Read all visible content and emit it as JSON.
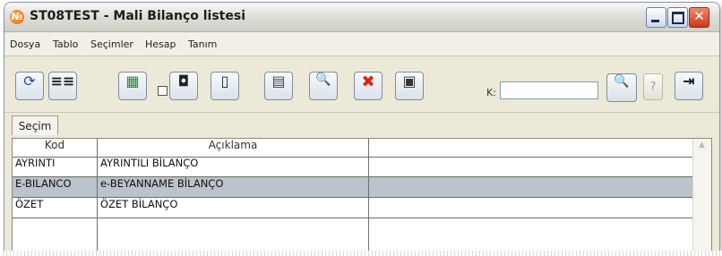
{
  "window": {
    "title": "ST08TEST - Mali Bilanço listesi",
    "app_icon_letter": "№",
    "controls": {
      "minimize": "_",
      "maximize": "□",
      "close": "✕"
    }
  },
  "menu": [
    {
      "label": "Dosya"
    },
    {
      "label": "Tablo"
    },
    {
      "label": "Seçimler"
    },
    {
      "label": "Hesap"
    },
    {
      "label": "Tanım"
    }
  ],
  "toolbar": {
    "buttons": [
      {
        "icon": "refresh-icon",
        "glyph": "⟳"
      },
      {
        "icon": "list-view-icon",
        "glyph": "≡≡"
      },
      {
        "icon": "excel-export-icon",
        "glyph": "▦"
      },
      {
        "icon": "small-page-icon",
        "glyph": "◘"
      },
      {
        "icon": "blank-page-icon",
        "glyph": "▯"
      },
      {
        "icon": "document-icon",
        "glyph": "▤"
      },
      {
        "icon": "search-icon",
        "glyph": "🔍"
      },
      {
        "icon": "delete-icon",
        "glyph": "✖"
      },
      {
        "icon": "copy-icon",
        "glyph": "▣"
      }
    ],
    "search": {
      "label": "K:",
      "value": ""
    },
    "search_button_glyph": "🔍",
    "help_glyph": "?",
    "exit_glyph": "⇥",
    "accent": "#2a4aa0",
    "delete_color": "#e02010"
  },
  "tabs": [
    {
      "label": "Seçim"
    }
  ],
  "grid": {
    "columns": [
      "Kod",
      "Açıklama",
      ""
    ],
    "rows": [
      {
        "kod": "AYRINTI",
        "aciklama": "AYRINTILI BİLANÇO",
        "selected": false
      },
      {
        "kod": "E-BILANCO",
        "aciklama": "e-BEYANNAME BİLANÇO",
        "selected": true
      },
      {
        "kod": "ÖZET",
        "aciklama": "ÖZET BİLANÇO",
        "selected": false
      },
      {
        "kod": "",
        "aciklama": "",
        "selected": false
      }
    ],
    "selected_row_color": "#bac3cb",
    "scroll_up_glyph": "▲"
  }
}
